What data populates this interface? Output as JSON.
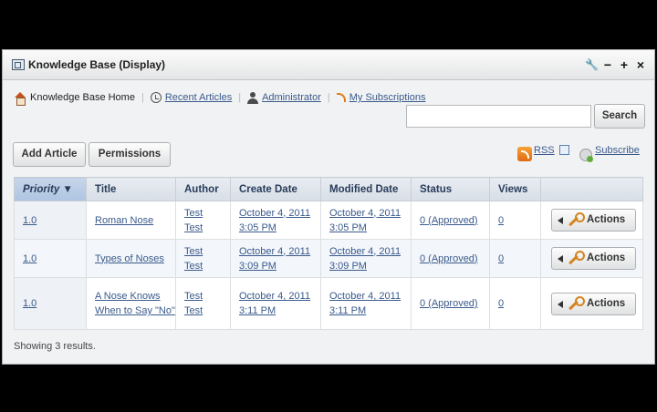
{
  "portlet": {
    "title": "Knowledge Base (Display)",
    "controls": {
      "configure": "🔧",
      "minimize": "−",
      "maximize": "+",
      "close": "×"
    }
  },
  "nav": {
    "home": "Knowledge Base Home",
    "recent": "Recent Articles",
    "admin": "Administrator",
    "subscriptions": "My Subscriptions"
  },
  "search": {
    "value": "",
    "button": "Search"
  },
  "toolbar": {
    "add_article": "Add Article",
    "permissions": "Permissions",
    "rss": "RSS",
    "subscribe": "Subscribe"
  },
  "table": {
    "columns": [
      "Priority ▼",
      "Title",
      "Author",
      "Create Date",
      "Modified Date",
      "Status",
      "Views",
      ""
    ],
    "rows": [
      {
        "priority": "1.0",
        "title": "Roman Nose",
        "author1": "Test",
        "author2": "Test",
        "create1": "October 4, 2011",
        "create2": "3:05 PM",
        "mod1": "October 4, 2011",
        "mod2": "3:05 PM",
        "status": "0 (Approved)",
        "views": "0",
        "action": "Actions"
      },
      {
        "priority": "1.0",
        "title": "Types of Noses",
        "author1": "Test",
        "author2": "Test",
        "create1": "October 4, 2011",
        "create2": "3:09 PM",
        "mod1": "October 4, 2011",
        "mod2": "3:09 PM",
        "status": "0 (Approved)",
        "views": "0",
        "action": "Actions"
      },
      {
        "priority": "1.0",
        "title": "A Nose Knows When to Say \"No\"",
        "author1": "Test",
        "author2": "Test",
        "create1": "October 4, 2011",
        "create2": "3:11 PM",
        "mod1": "October 4, 2011",
        "mod2": "3:11 PM",
        "status": "0 (Approved)",
        "views": "0",
        "action": "Actions"
      }
    ]
  },
  "footer": "Showing 3 results."
}
